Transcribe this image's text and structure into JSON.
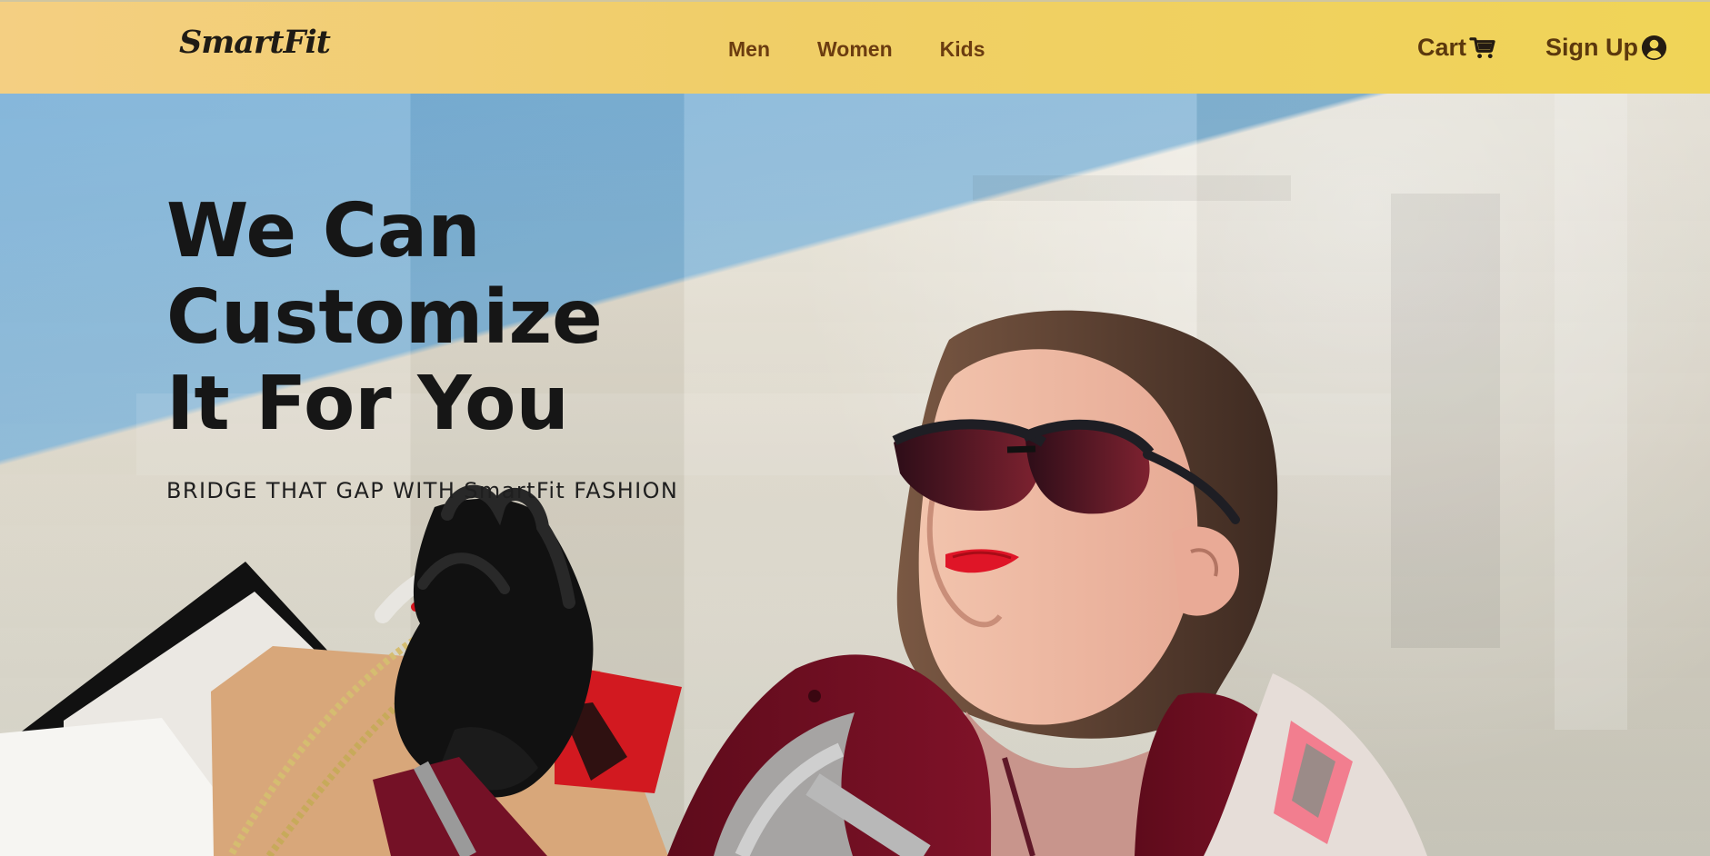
{
  "header": {
    "brand": "SmartFit",
    "nav": [
      "Men",
      "Women",
      "Kids"
    ],
    "cart_label": "Cart",
    "signup_label": "Sign Up"
  },
  "hero": {
    "headline_line_1": "We Can Customize",
    "headline_line_2": "It For You",
    "subtitle": "BRIDGE THAT GAP WITH SmartFit FASHION"
  },
  "icons": {
    "cart": "shopping-cart-icon",
    "user": "user-circle-icon"
  },
  "colors": {
    "header_start": "#f4cf82",
    "header_end": "#f0d457",
    "nav_text": "#6b3c10",
    "headline_text": "#161616"
  }
}
